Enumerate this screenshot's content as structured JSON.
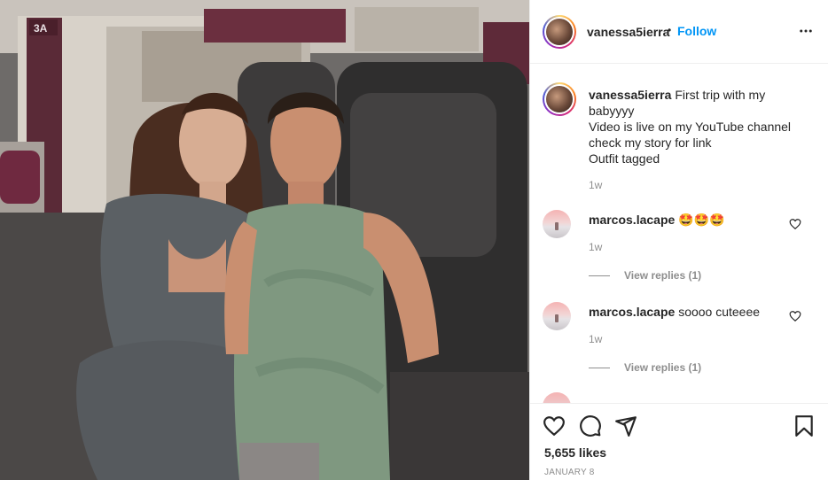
{
  "post": {
    "seat_label": "3A"
  },
  "header": {
    "username": "vanessa5ierra",
    "separator": "•",
    "follow_label": "Follow",
    "more_icon": "more-options-icon"
  },
  "caption": {
    "username": "vanessa5ierra",
    "lines": [
      "First trip with my",
      "babyyyy",
      "Video is live on my YouTube channel",
      "check my story for link",
      "Outfit tagged"
    ],
    "time": "1w"
  },
  "comments": [
    {
      "username": "marcos.lacape",
      "text": "🤩🤩🤩",
      "time": "1w",
      "view_replies": "View replies (1)"
    },
    {
      "username": "marcos.lacape",
      "text": "soooo cuteeee",
      "time": "1w",
      "view_replies": "View replies (1)"
    }
  ],
  "actions": {
    "likes": "5,655 likes",
    "date": "JANUARY 8",
    "icons": [
      "like-icon",
      "comment-icon",
      "share-icon",
      "save-icon"
    ]
  },
  "colors": {
    "follow_blue": "#0095f6",
    "text_primary": "#262626",
    "text_secondary": "#8e8e8e",
    "divider": "#efefef"
  }
}
